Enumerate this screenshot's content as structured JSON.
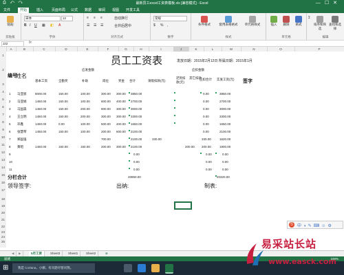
{
  "window": {
    "title": "最新员工excel工资表模板.xls [兼容模式] - Excel",
    "controls": [
      "—",
      "☐",
      "✕"
    ],
    "quick_access": "⎙ ↶ ↷"
  },
  "ribbon_tabs": [
    "文件",
    "开始",
    "插入",
    "页面布局",
    "公式",
    "数据",
    "审阅",
    "视图",
    "开发工具"
  ],
  "ribbon": {
    "font_name": "宋体",
    "font_size": "12",
    "number_format": "常规",
    "groups": [
      "剪贴板",
      "字体",
      "对齐方式",
      "数字",
      "样式",
      "单元格",
      "编辑"
    ],
    "buttons": {
      "paste": "粘贴",
      "wrap": "自动换行",
      "merge": "合并后居中",
      "cond_format": "条件格式",
      "table_format": "套用表格格式",
      "cell_style": "单元格样式",
      "insert": "插入",
      "delete": "删除",
      "format": "格式",
      "sort": "排序和筛选",
      "find": "查找和选择"
    }
  },
  "formula_bar": {
    "name_box": "J22",
    "fx": "fx",
    "value": ""
  },
  "columns": [
    "A",
    "B",
    "C",
    "D",
    "E",
    "F",
    "G",
    "H",
    "I",
    "J",
    "K",
    "L",
    "M",
    "N",
    "O",
    "P"
  ],
  "rows": [
    "1",
    "2",
    "3",
    "4",
    "5",
    "6",
    "7",
    "8",
    "9",
    "10",
    "11",
    "12",
    "13",
    "14",
    "15",
    "16",
    "17",
    "18",
    "19",
    "20",
    "21",
    "22",
    "23",
    "24",
    "25",
    "26",
    "27"
  ],
  "sheet": {
    "title": "员工工资表",
    "issue_date": "发放日期：2015年2月12日 所属日期：2015年1月",
    "labels": {
      "seq": "编号",
      "name": "姓名",
      "should_pay": "应发金额",
      "deductions": "应扣金额",
      "base": "基本工资",
      "full_att": "全勤奖",
      "subsidy": "补助",
      "post": "岗位",
      "bonus": "奖金",
      "total": "合计",
      "late": "请假扣款(元)",
      "late2": "迟到扣款(元)",
      "social": "其它扣款",
      "ded_total": "应扣合计",
      "actual": "实发工资(元)",
      "sign": "签字",
      "subtotal": "分栏合计",
      "leader": "领导签字:",
      "cashier": "出纳:",
      "maker": "制表:"
    },
    "employees": [
      {
        "no": "1",
        "name": "马亚丽",
        "base": "8000.00",
        "full": "150.00",
        "sub": "100.00",
        "post": "300.00",
        "bonus": "300.00",
        "total": "3850.00",
        "ded": "0.00",
        "actual": "3850.00"
      },
      {
        "no": "2",
        "name": "马亚娟",
        "base": "1450.00",
        "full": "150.00",
        "sub": "100.00",
        "post": "600.00",
        "bonus": "400.00",
        "total": "2700.00",
        "ded": "0.00",
        "actual": "2700.00"
      },
      {
        "no": "3",
        "name": "马国森",
        "base": "1450.00",
        "full": "150.00",
        "sub": "200.00",
        "post": "900.00",
        "bonus": "300.00",
        "total": "3000.00",
        "ded": "0.00",
        "actual": "3000.00"
      },
      {
        "no": "4",
        "name": "王立明",
        "base": "1450.00",
        "full": "150.00",
        "sub": "200.00",
        "post": "300.00",
        "bonus": "300.00",
        "total": "3300.00",
        "ded": "0.00",
        "actual": "3300.00"
      },
      {
        "no": "5",
        "name": "邓鑫",
        "base": "1450.00",
        "full": "0.00",
        "sub": "100.00",
        "post": "500.00",
        "bonus": "400.00",
        "total": "1650.00",
        "ded": "0.00",
        "actual": "1650.00"
      },
      {
        "no": "6",
        "name": "张慧琴",
        "base": "1450.00",
        "full": "150.00",
        "sub": "100.00",
        "post": "200.00",
        "bonus": "600.00",
        "total": "2100.00",
        "ded": "0.00",
        "actual": "2100.00"
      },
      {
        "no": "7",
        "name": "郑国强",
        "base": "",
        "full": "",
        "sub": "",
        "post": "700.00",
        "bonus": "",
        "total": "2100.00",
        "late": "330.00",
        "ded": "330.00",
        "actual": "1620.00"
      },
      {
        "no": "8",
        "name": "黄昭",
        "base": "1450.00",
        "full": "150.00",
        "sub": "150.00",
        "post": "200.00",
        "bonus": "300.00",
        "total": "2100.00",
        "other": "200.00",
        "ded": "200.00",
        "actual": "1900.00"
      },
      {
        "no": "9",
        "name": "",
        "total": "0.00",
        "ded": "0.00",
        "actual": "0.00"
      },
      {
        "no": "10",
        "name": "",
        "total": "0.00",
        "ded": "0.00",
        "actual": "0.00"
      },
      {
        "no": "11",
        "name": "",
        "total": "0.00",
        "ded": "0.00",
        "actual": "0.00"
      }
    ],
    "grand_total": "20850.00",
    "grand_actual": "20320.00"
  },
  "sheet_tabs": [
    "5月工资",
    "Sheet3",
    "Sheet1",
    "Sheet2",
    "⊕"
  ],
  "status": {
    "left": "就绪",
    "right": "100%"
  },
  "taskbar": {
    "cortana": "我是 Cortana，小娜。有问题尽管问我。"
  },
  "watermark": {
    "text": "易采站长站",
    "url": "www.easck.com"
  },
  "colors": {
    "excel_green": "#217346",
    "watermark_red": "#c71f3f"
  }
}
